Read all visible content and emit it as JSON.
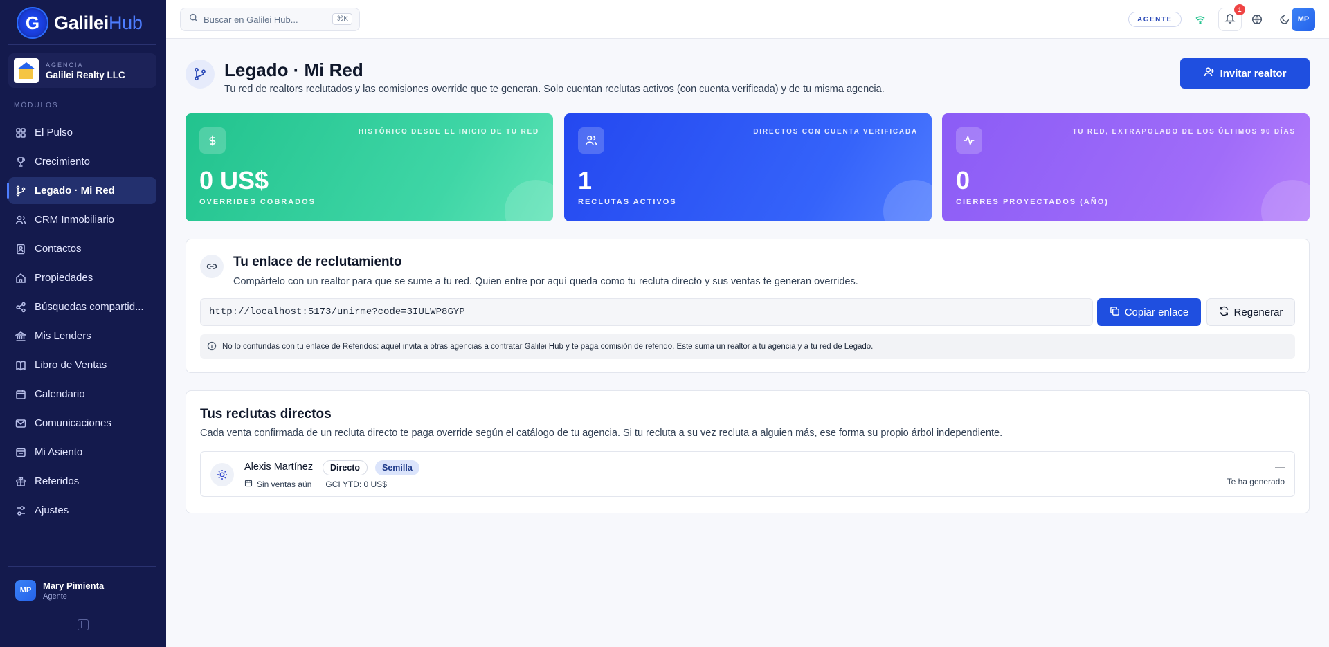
{
  "brand": {
    "name": "Galilei",
    "accent": "Hub",
    "logo_letter": "G"
  },
  "agency": {
    "label": "AGENCIA",
    "name": "Galilei Realty LLC"
  },
  "sidebar": {
    "section_label": "MÓDULOS",
    "items": [
      {
        "label": "El Pulso",
        "icon": "grid-icon"
      },
      {
        "label": "Crecimiento",
        "icon": "trophy-icon"
      },
      {
        "label": "Legado · Mi Red",
        "icon": "branch-icon",
        "active": true
      },
      {
        "label": "CRM Inmobiliario",
        "icon": "users-icon"
      },
      {
        "label": "Contactos",
        "icon": "contact-icon"
      },
      {
        "label": "Propiedades",
        "icon": "home-icon"
      },
      {
        "label": "Búsquedas compartid...",
        "icon": "share-icon"
      },
      {
        "label": "Mis Lenders",
        "icon": "bank-icon"
      },
      {
        "label": "Libro de Ventas",
        "icon": "book-icon"
      },
      {
        "label": "Calendario",
        "icon": "calendar-icon"
      },
      {
        "label": "Comunicaciones",
        "icon": "mail-icon"
      },
      {
        "label": "Mi Asiento",
        "icon": "seat-icon"
      },
      {
        "label": "Referidos",
        "icon": "gift-icon"
      },
      {
        "label": "Ajustes",
        "icon": "sliders-icon"
      }
    ]
  },
  "user": {
    "initials": "MP",
    "name": "Mary Pimienta",
    "role": "Agente"
  },
  "topbar": {
    "search_placeholder": "Buscar en Galilei Hub...",
    "search_shortcut": "⌘K",
    "role_badge": "AGENTE",
    "notifications_count": "1",
    "avatar_initials": "MP"
  },
  "page": {
    "title": "Legado · Mi Red",
    "subtitle": "Tu red de realtors reclutados y las comisiones override que te generan. Solo cuentan reclutas activos (con cuenta verificada) y de tu misma agencia.",
    "invite_label": "Invitar realtor"
  },
  "stats": [
    {
      "caption": "HISTÓRICO DESDE EL INICIO DE TU RED",
      "value": "0 US$",
      "label": "OVERRIDES COBRADOS",
      "icon": "dollar-icon",
      "color": "#22c38e"
    },
    {
      "caption": "DIRECTOS CON CUENTA VERIFICADA",
      "value": "1",
      "label": "RECLUTAS ACTIVOS",
      "icon": "users-icon",
      "color": "#2448f0"
    },
    {
      "caption": "TU RED, EXTRAPOLADO DE LOS ÚLTIMOS 90 DÍAS",
      "value": "0",
      "label": "CIERRES PROYECTADOS (AÑO)",
      "icon": "activity-icon",
      "color": "#8b5cf6"
    }
  ],
  "recruit_link": {
    "title": "Tu enlace de reclutamiento",
    "subtitle": "Compártelo con un realtor para que se sume a tu red. Quien entre por aquí queda como tu recluta directo y sus ventas te generan overrides.",
    "url": "http://localhost:5173/unirme?code=3IULWP8GYP",
    "copy_label": "Copiar enlace",
    "regen_label": "Regenerar",
    "note": "No lo confundas con tu enlace de Referidos: aquel invita a otras agencias a contratar Galilei Hub y te paga comisión de referido. Este suma un realtor a tu agencia y a tu red de Legado."
  },
  "recruits": {
    "title": "Tus reclutas directos",
    "subtitle": "Cada venta confirmada de un recluta directo te paga override según el catálogo de tu agencia. Si tu recluta a su vez recluta a alguien más, ese forma su propio árbol independiente.",
    "items": [
      {
        "name": "Alexis Martínez",
        "tag1": "Directo",
        "tag2": "Semilla",
        "sales": "Sin ventas aún",
        "gci": "GCI YTD: 0 US$",
        "amount": "—",
        "amount_label": "Te ha generado"
      }
    ]
  }
}
